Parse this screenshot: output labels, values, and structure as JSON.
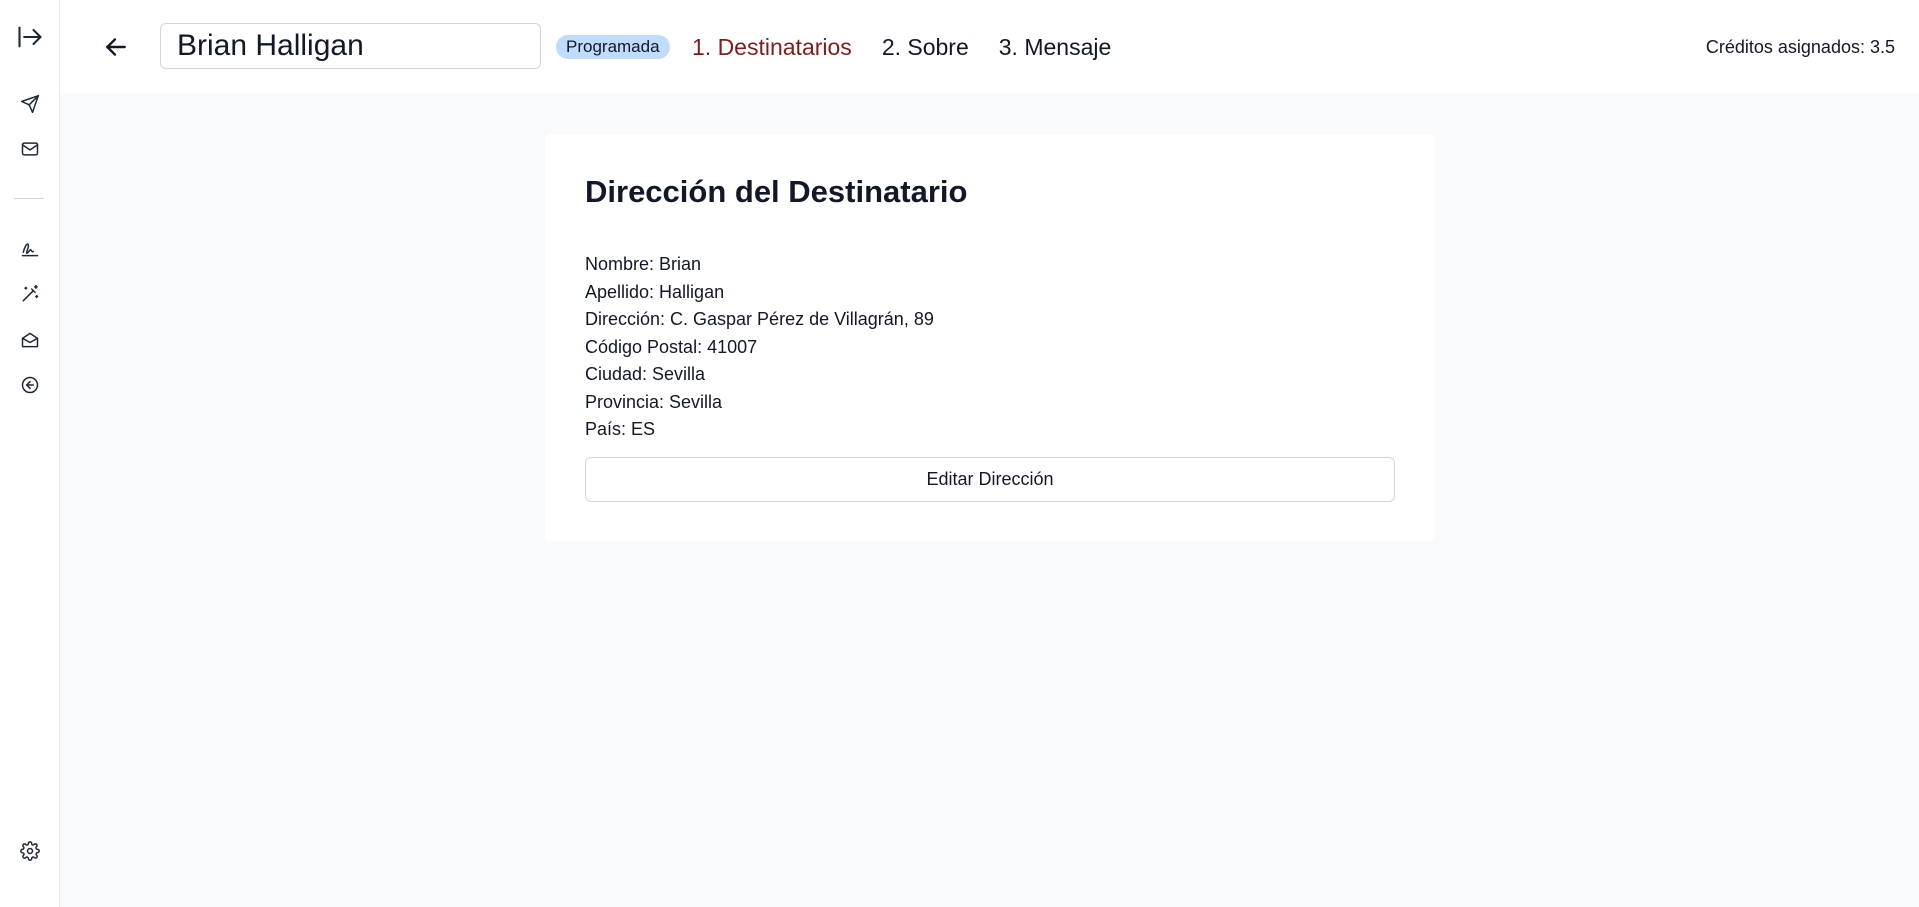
{
  "sidebar": {
    "items": [
      {
        "icon": "expand-sidebar-icon"
      },
      {
        "icon": "send-icon"
      },
      {
        "icon": "mail-icon"
      },
      {
        "icon": "signature-icon"
      },
      {
        "icon": "magic-wand-icon"
      },
      {
        "icon": "mail-open-icon"
      },
      {
        "icon": "back-circle-icon"
      },
      {
        "icon": "gear-icon"
      }
    ]
  },
  "header": {
    "title_value": "Brian Halligan",
    "status_badge": "Programada",
    "steps": [
      {
        "label": "1. Destinatarios",
        "active": true
      },
      {
        "label": "2. Sobre",
        "active": false
      },
      {
        "label": "3. Mensaje",
        "active": false
      }
    ],
    "credits": "Créditos asignados: 3.5"
  },
  "card": {
    "title": "Dirección del Destinatario",
    "fields": [
      "Nombre: Brian",
      "Apellido: Halligan",
      "Dirección: C. Gaspar Pérez de Villagrán, 89",
      "Código Postal: 41007",
      "Ciudad: Sevilla",
      "Provincia: Sevilla",
      "País: ES"
    ],
    "edit_button": "Editar Dirección"
  },
  "colors": {
    "active_step": "#7f1d1d",
    "badge_bg": "#bfdbfe",
    "page_bg": "#f9fafb",
    "card_bg": "#ffffff"
  }
}
